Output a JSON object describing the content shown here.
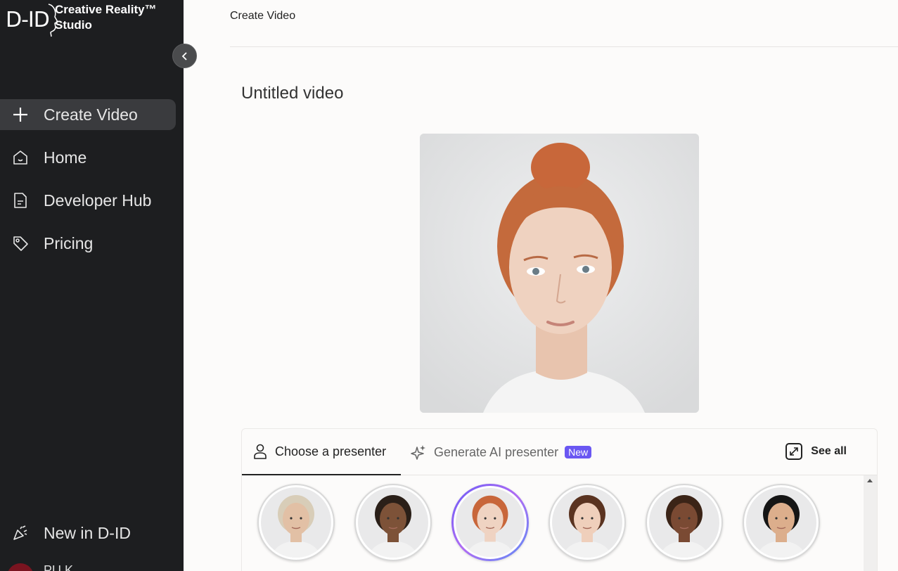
{
  "app": {
    "logo": "D-ID",
    "studio_name": "Creative Reality™ Studio"
  },
  "sidebar": {
    "items": [
      {
        "label": "Create Video",
        "icon": "plus-icon",
        "active": true
      },
      {
        "label": "Home",
        "icon": "home-icon"
      },
      {
        "label": "Developer Hub",
        "icon": "document-icon"
      },
      {
        "label": "Pricing",
        "icon": "tag-icon"
      }
    ],
    "bottom": {
      "label": "New in D-ID",
      "icon": "party-popper-icon"
    },
    "user": {
      "initials": "PU K"
    }
  },
  "header": {
    "title": "Create Video"
  },
  "main": {
    "video_title": "Untitled video",
    "tabs": [
      {
        "label": "Choose a presenter",
        "icon": "person-icon",
        "active": true
      },
      {
        "label": "Generate AI presenter",
        "icon": "sparkle-icon",
        "badge": "New"
      }
    ],
    "see_all": "See all",
    "presenters": [
      {
        "name": "presenter-1",
        "hair": "#d8cdb8",
        "skin": "#e2c0a5",
        "selected": false
      },
      {
        "name": "presenter-2",
        "hair": "#2a1f18",
        "skin": "#7d5238",
        "selected": false
      },
      {
        "name": "presenter-3",
        "hair": "#c8663a",
        "skin": "#efd3c2",
        "selected": true
      },
      {
        "name": "presenter-4",
        "hair": "#5a3320",
        "skin": "#efcfbb",
        "selected": false
      },
      {
        "name": "presenter-5",
        "hair": "#3b2417",
        "skin": "#7a4a33",
        "selected": false
      },
      {
        "name": "presenter-6",
        "hair": "#151515",
        "skin": "#dcae8c",
        "selected": false
      }
    ]
  },
  "colors": {
    "sidebar_bg": "#1d1e20",
    "accent_purple": "#6a57f2",
    "main_bg": "#fcfbfa"
  }
}
